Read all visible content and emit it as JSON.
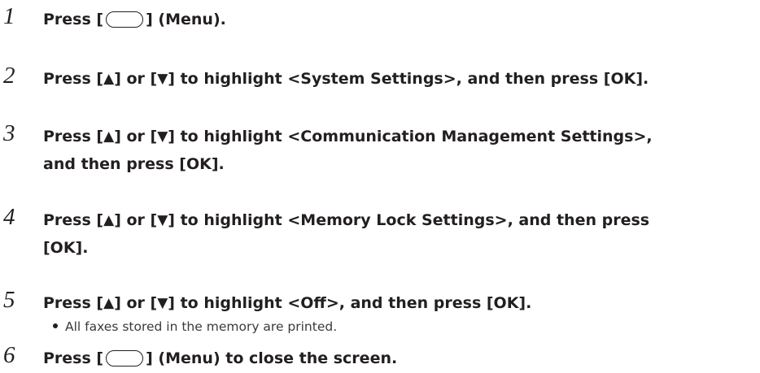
{
  "steps": [
    {
      "number": "1",
      "parts": {
        "before": "Press [",
        "after": "] (Menu)."
      },
      "key_icon": "menu-key-icon"
    },
    {
      "number": "2",
      "parts": {
        "a": "Press [",
        "up": "▲",
        "b": "] or [",
        "down": "▼",
        "c": "] to highlight <System Settings>, and then press [OK]."
      }
    },
    {
      "number": "3",
      "parts": {
        "a": "Press [",
        "up": "▲",
        "b": "] or [",
        "down": "▼",
        "c": "] to highlight <Communication Management Settings>,",
        "line2": "and then press [OK]."
      }
    },
    {
      "number": "4",
      "parts": {
        "a": "Press [",
        "up": "▲",
        "b": "] or [",
        "down": "▼",
        "c": "] to highlight <Memory Lock Settings>, and then press",
        "line2": "[OK]."
      }
    },
    {
      "number": "5",
      "parts": {
        "a": "Press [",
        "up": "▲",
        "b": "] or [",
        "down": "▼",
        "c": "] to highlight <Off>, and then press [OK]."
      },
      "bullets": [
        "All faxes stored in the memory are printed."
      ]
    },
    {
      "number": "6",
      "parts": {
        "before": "Press [",
        "after": "] (Menu) to close the screen."
      },
      "key_icon": "menu-key-icon"
    }
  ],
  "colors": {
    "text": "#231f20"
  }
}
